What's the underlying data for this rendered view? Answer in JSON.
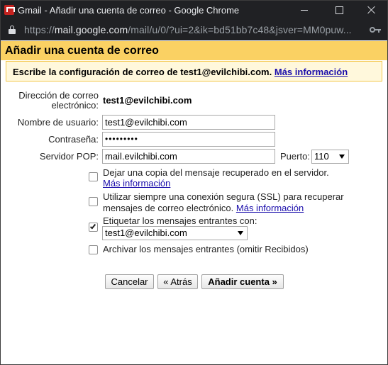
{
  "window": {
    "title": "Gmail - Añadir una cuenta de correo - Google Chrome"
  },
  "addressbar": {
    "url_protocol": "https://",
    "url_host": "mail.google.com",
    "url_path": "/mail/u/0/?ui=2&ik=bd51bb7c48&jsver=MM0puw..."
  },
  "dialog": {
    "title": "Añadir una cuenta de correo",
    "instruction": "Escribe la configuración de correo de test1@evilchibi.com.",
    "instruction_link": "Más información",
    "email_label": "Dirección de correo electrónico:",
    "email_value": "test1@evilchibi.com",
    "username_label": "Nombre de usuario:",
    "username_value": "test1@evilchibi.com",
    "password_label": "Contraseña:",
    "password_value": "•••••••••",
    "pop_label": "Servidor POP:",
    "pop_value": "mail.evilchibi.com",
    "port_label": "Puerto:",
    "port_value": "110",
    "options": [
      {
        "text": "Dejar una copia del mensaje recuperado en el servidor.",
        "link": "Más información",
        "checked": false
      },
      {
        "text_line1": "Utilizar siempre una conexión segura (SSL) para recuperar",
        "text_line2": "mensajes de correo electrónico.",
        "link": "Más información",
        "checked": false
      },
      {
        "text": "Etiquetar los mensajes entrantes con:",
        "select_value": "test1@evilchibi.com",
        "checked": true
      },
      {
        "text": "Archivar los mensajes entrantes (omitir Recibidos)",
        "checked": false
      }
    ],
    "buttons": {
      "cancel": "Cancelar",
      "back": "« Atrás",
      "add": "Añadir cuenta »"
    }
  },
  "colors": {
    "header_bg": "#fad163",
    "instruction_bg": "#fff8dc",
    "link": "#1a0dab",
    "chrome_bg": "#202124"
  }
}
